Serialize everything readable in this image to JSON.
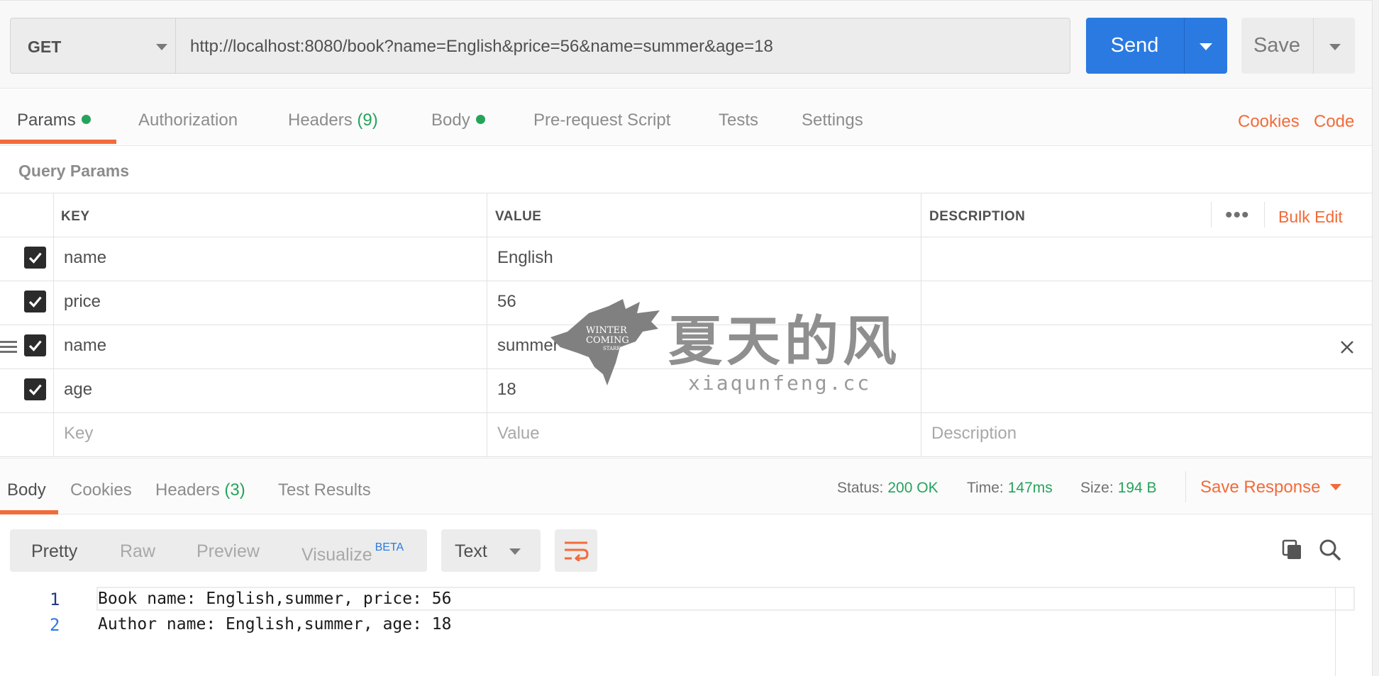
{
  "request": {
    "method": "GET",
    "url": "http://localhost:8080/book?name=English&price=56&name=summer&age=18",
    "send_label": "Send",
    "save_label": "Save"
  },
  "request_tabs": [
    {
      "label": "Params",
      "active": true,
      "dot": true
    },
    {
      "label": "Authorization"
    },
    {
      "label": "Headers",
      "count": "(9)"
    },
    {
      "label": "Body",
      "dot": true
    },
    {
      "label": "Pre-request Script"
    },
    {
      "label": "Tests"
    },
    {
      "label": "Settings"
    }
  ],
  "request_links": {
    "cookies": "Cookies",
    "code": "Code"
  },
  "query_params": {
    "title": "Query Params",
    "headers": {
      "key": "KEY",
      "value": "VALUE",
      "description": "DESCRIPTION",
      "more": "•••",
      "bulk_edit": "Bulk Edit"
    },
    "rows": [
      {
        "key": "name",
        "value": "English",
        "checked": true
      },
      {
        "key": "price",
        "value": "56",
        "checked": true
      },
      {
        "key": "name",
        "value": "summer",
        "checked": true
      },
      {
        "key": "age",
        "value": "18",
        "checked": true
      }
    ],
    "placeholders": {
      "key": "Key",
      "value": "Value",
      "description": "Description"
    }
  },
  "watermark": {
    "badge_lines": [
      "WINTER",
      "COMING",
      "STARK"
    ],
    "chinese": "夏天的风",
    "site": "xiaqunfeng.cc"
  },
  "response_tabs": [
    {
      "label": "Body",
      "active": true
    },
    {
      "label": "Cookies"
    },
    {
      "label": "Headers",
      "count": "(3)"
    },
    {
      "label": "Test Results"
    }
  ],
  "response_meta": {
    "status_label": "Status:",
    "status": "200 OK",
    "time_label": "Time:",
    "time": "147ms",
    "size_label": "Size:",
    "size": "194 B",
    "save_response": "Save Response"
  },
  "response_view": {
    "modes": [
      {
        "label": "Pretty",
        "active": true
      },
      {
        "label": "Raw"
      },
      {
        "label": "Preview"
      },
      {
        "label": "Visualize",
        "badge": "BETA"
      }
    ],
    "format": "Text"
  },
  "response_body": [
    {
      "n": "1",
      "text": "Book name: English,summer, price: 56"
    },
    {
      "n": "2",
      "text": "Author name: English,summer, age: 18"
    }
  ],
  "colors": {
    "accent": "#f26b3a",
    "primary": "#2a7ae2",
    "success": "#26a35b"
  }
}
